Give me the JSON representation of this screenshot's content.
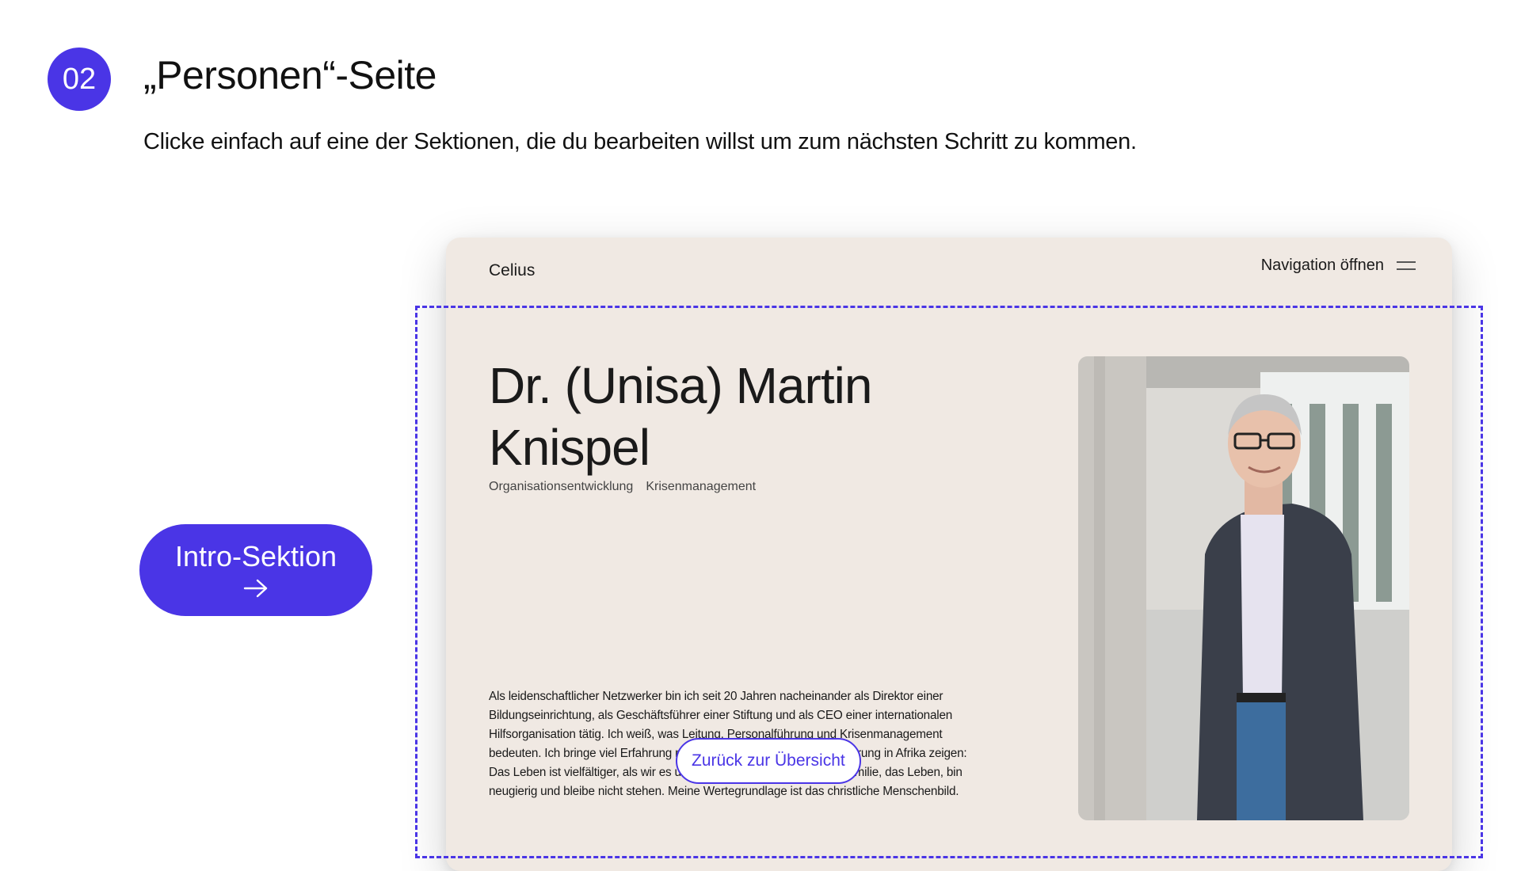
{
  "header": {
    "step_number": "02",
    "title": "„Personen“-Seite",
    "instruction": "Clicke einfach auf eine der Sektionen, die du bearbeiten willst um zum nächsten Schritt zu kommen."
  },
  "section_button": {
    "label": "Intro-Sektion",
    "icon": "arrow-right-icon"
  },
  "preview": {
    "logo": "Celius",
    "nav_label": "Navigation öffnen",
    "nav_icon": "hamburger-icon",
    "person_name": "Dr. (Unisa) Martin Knispel",
    "tags": [
      "Organisationsentwicklung",
      "Krisenmanagement"
    ],
    "bio": "Als leidenschaftlicher Netzwerker bin ich seit 20 Jahren nacheinander als Direktor einer Bildungseinrichtung, als Geschäftsführer einer Stiftung und als CEO einer internationalen Hilfsorganisation tätig. Ich weiß, was Leitung, Personalführung und Krisenmanagement bedeuten. Ich bringe viel Erfahrung mit. Acht Jahre interkulturelle Erfahrung in Afrika zeigen: Das Leben ist vielfältiger, als wir es uns oft denken. Ich liebe meine Familie, das Leben, bin neugierig und bleibe nicht stehen. Meine Wertegrundlage ist das christliche Menschenbild.",
    "back_button": "Zurück zur Übersicht",
    "photo_icon": "portrait-photo"
  },
  "colors": {
    "accent": "#4a35e6",
    "preview_background": "#f0e9e3"
  }
}
